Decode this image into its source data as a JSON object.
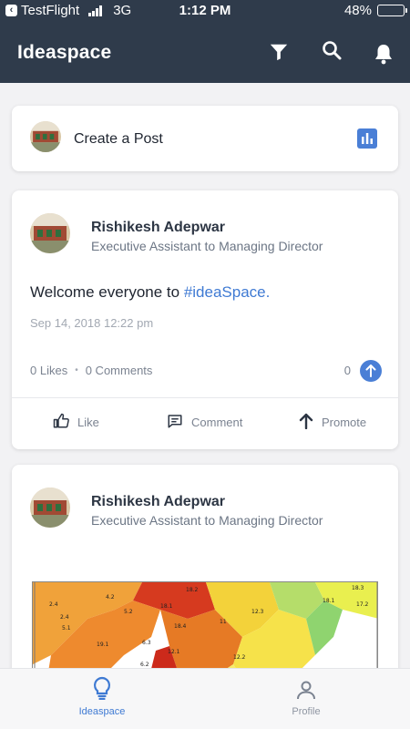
{
  "status_bar": {
    "back_app": "TestFlight",
    "network": "3G",
    "time": "1:12 PM",
    "battery": "48%",
    "battery_level": 0.48
  },
  "app_bar": {
    "title": "Ideaspace",
    "icons": [
      "filter-icon",
      "search-icon",
      "bell-icon"
    ]
  },
  "create_post": {
    "label": "Create a Post",
    "icon": "poll-chart-icon"
  },
  "posts": [
    {
      "author": "Rishikesh Adepwar",
      "role": "Executive Assistant to Managing Director",
      "body_text": "Welcome everyone to ",
      "body_tag": "#ideaSpace.",
      "date": "Sep 14, 2018 12:22 pm",
      "likes": "0 Likes",
      "separator": "•",
      "comments": "0 Comments",
      "promote_count": "0",
      "actions": {
        "like": "Like",
        "comment": "Comment",
        "promote": "Promote"
      }
    },
    {
      "author": "Rishikesh Adepwar",
      "role": "Executive Assistant to Managing Director",
      "map_labels": [
        "4.2",
        "18.2",
        "18.1",
        "2.4",
        "5.2",
        "18.4",
        "11",
        "12.3",
        "18.1",
        "18.3",
        "17.2",
        "2.4",
        "5.1",
        "6.3",
        "12.1",
        "12.2",
        "19.1",
        "6.2"
      ]
    }
  ],
  "bottom_nav": {
    "items": [
      {
        "label": "Ideaspace",
        "icon": "lightbulb-icon",
        "active": true
      },
      {
        "label": "Profile",
        "icon": "person-icon",
        "active": false
      }
    ]
  },
  "colors": {
    "app_bar": "#2f3b4b",
    "accent": "#4a7fd6",
    "hashtag": "#3f7ad3",
    "background": "#f2f2f4"
  }
}
